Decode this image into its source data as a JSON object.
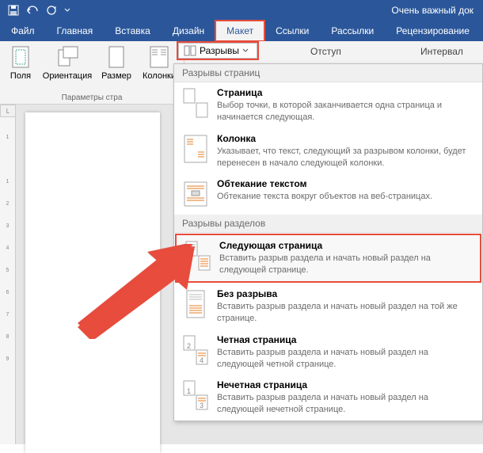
{
  "window": {
    "title": "Очень важный док"
  },
  "tabs": {
    "file": "Файл",
    "home": "Главная",
    "insert": "Вставка",
    "design": "Дизайн",
    "layout": "Макет",
    "references": "Ссылки",
    "mailings": "Рассылки",
    "review": "Рецензирование"
  },
  "ribbon": {
    "margins": "Поля",
    "orientation": "Ориентация",
    "size": "Размер",
    "columns": "Колонки",
    "page_setup_group": "Параметры стра",
    "breaks": "Разрывы",
    "indent": "Отступ",
    "spacing": "Интервал"
  },
  "dropdown": {
    "section_pages": "Разрывы страниц",
    "section_sections": "Разрывы разделов",
    "items": {
      "page": {
        "title": "Страница",
        "desc": "Выбор точки, в которой заканчивается одна страница и начинается следующая."
      },
      "column": {
        "title": "Колонка",
        "desc": "Указывает, что текст, следующий за разрывом колонки, будет перенесен в начало следующей колонки."
      },
      "text_wrap": {
        "title": "Обтекание текстом",
        "desc": "Обтекание текста вокруг объектов на веб-страницах."
      },
      "next_page": {
        "title": "Следующая страница",
        "desc": "Вставить разрыв раздела и начать новый раздел на следующей странице."
      },
      "continuous": {
        "title": "Без разрыва",
        "desc": "Вставить разрыв раздела и начать новый раздел на той же странице."
      },
      "even_page": {
        "title": "Четная страница",
        "desc": "Вставить разрыв раздела и начать новый раздел на следующей четной странице."
      },
      "odd_page": {
        "title": "Нечетная страница",
        "desc": "Вставить разрыв раздела и начать новый раздел на следующей нечетной странице."
      }
    }
  },
  "ruler_label": "L"
}
